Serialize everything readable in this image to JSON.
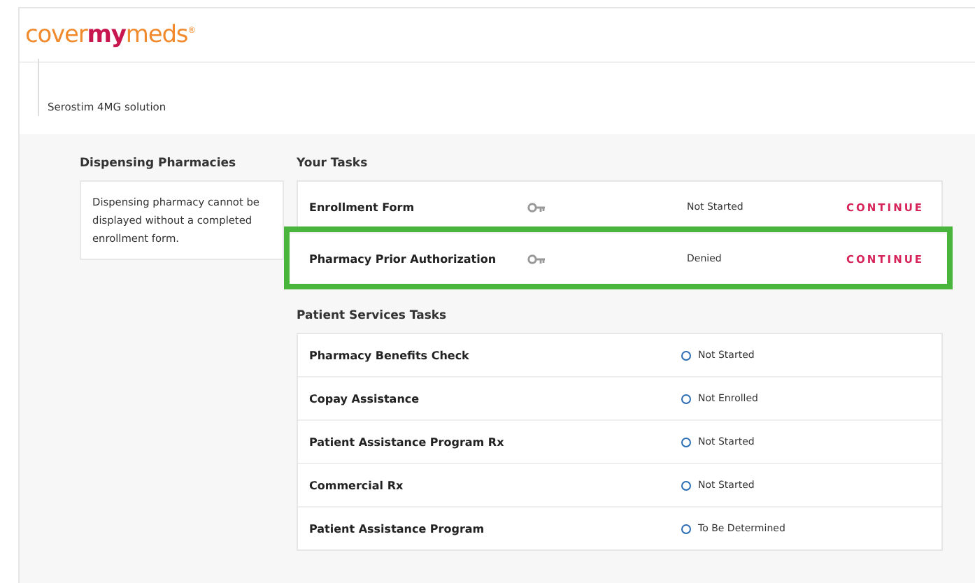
{
  "logo": {
    "parts": [
      "cover",
      "my",
      "meds"
    ],
    "mark": "®"
  },
  "drug": "Serostim 4MG solution",
  "dispensing": {
    "title": "Dispensing Pharmacies",
    "message": "Dispensing pharmacy cannot be displayed without a completed enrollment form."
  },
  "your_tasks": {
    "title": "Your Tasks",
    "rows": [
      {
        "name": "Enrollment Form",
        "status": "Not Started",
        "action": "CONTINUE",
        "highlighted": false
      },
      {
        "name": "Pharmacy Prior Authorization",
        "status": "Denied",
        "action": "CONTINUE",
        "highlighted": true
      }
    ]
  },
  "patient_services": {
    "title": "Patient Services Tasks",
    "rows": [
      {
        "name": "Pharmacy Benefits Check",
        "status": "Not Started"
      },
      {
        "name": "Copay Assistance",
        "status": "Not Enrolled"
      },
      {
        "name": "Patient Assistance Program Rx",
        "status": "Not Started"
      },
      {
        "name": "Commercial Rx",
        "status": "Not Started"
      },
      {
        "name": "Patient Assistance Program",
        "status": "To Be Determined"
      }
    ]
  }
}
